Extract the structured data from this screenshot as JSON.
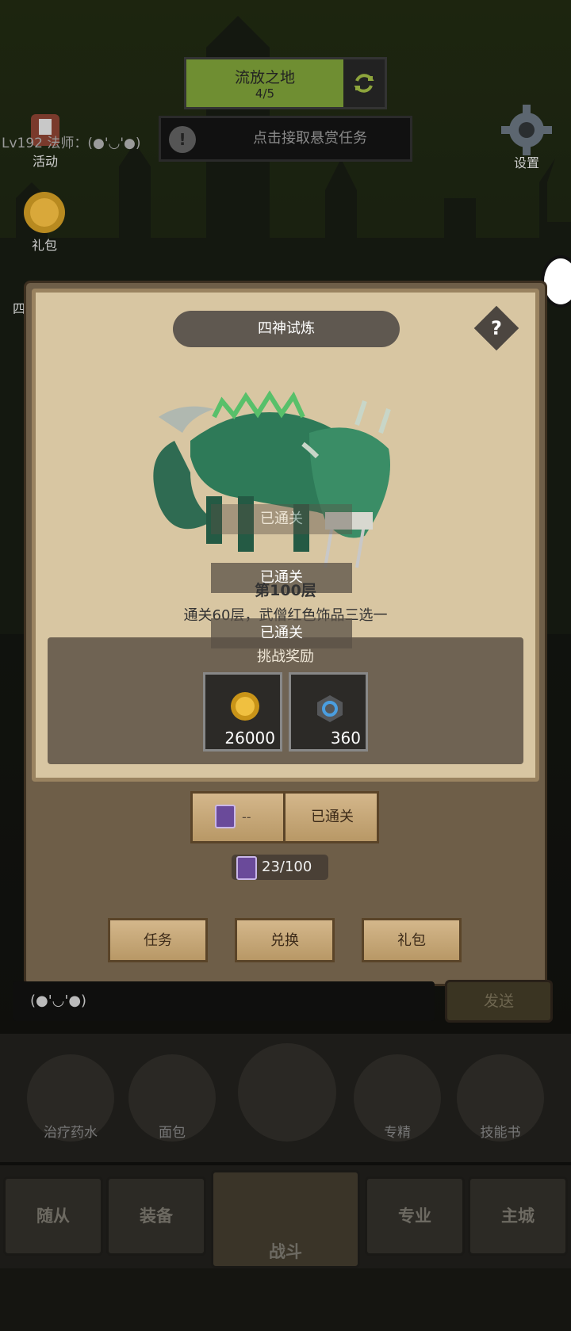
{
  "zone": {
    "name": "流放之地",
    "progress": "4/5"
  },
  "bounty": {
    "text": "点击接取悬赏任务"
  },
  "player": {
    "level_text": "Lv192 法师：(●'◡'●)"
  },
  "side_left": {
    "activity": "活动",
    "giftpack": "礼包",
    "partial": "四"
  },
  "settings_label": "设置",
  "modal": {
    "title": "四神试炼",
    "help": "?",
    "cleared_tags": [
      "已通关",
      "已通关",
      "已通关"
    ],
    "floor": "第100层",
    "description": "通关60层，武僧红色饰品三选一",
    "reward_title": "挑战奖励",
    "rewards": [
      {
        "icon": "gold-coin-icon",
        "count": "26000"
      },
      {
        "icon": "skill-stone-icon",
        "count": "360"
      }
    ],
    "exchange": {
      "cost": "--",
      "action": "已通关"
    },
    "ticket_count": "23/100",
    "buttons": {
      "task": "任务",
      "exchange": "兑换",
      "gift": "礼包"
    }
  },
  "chat": {
    "text": "(●'◡'●)",
    "send": "发送"
  },
  "consumables": [
    "治疗药水",
    "面包",
    "专精",
    "技能书"
  ],
  "nav": [
    "随从",
    "装备",
    "战斗",
    "专业",
    "主城"
  ]
}
